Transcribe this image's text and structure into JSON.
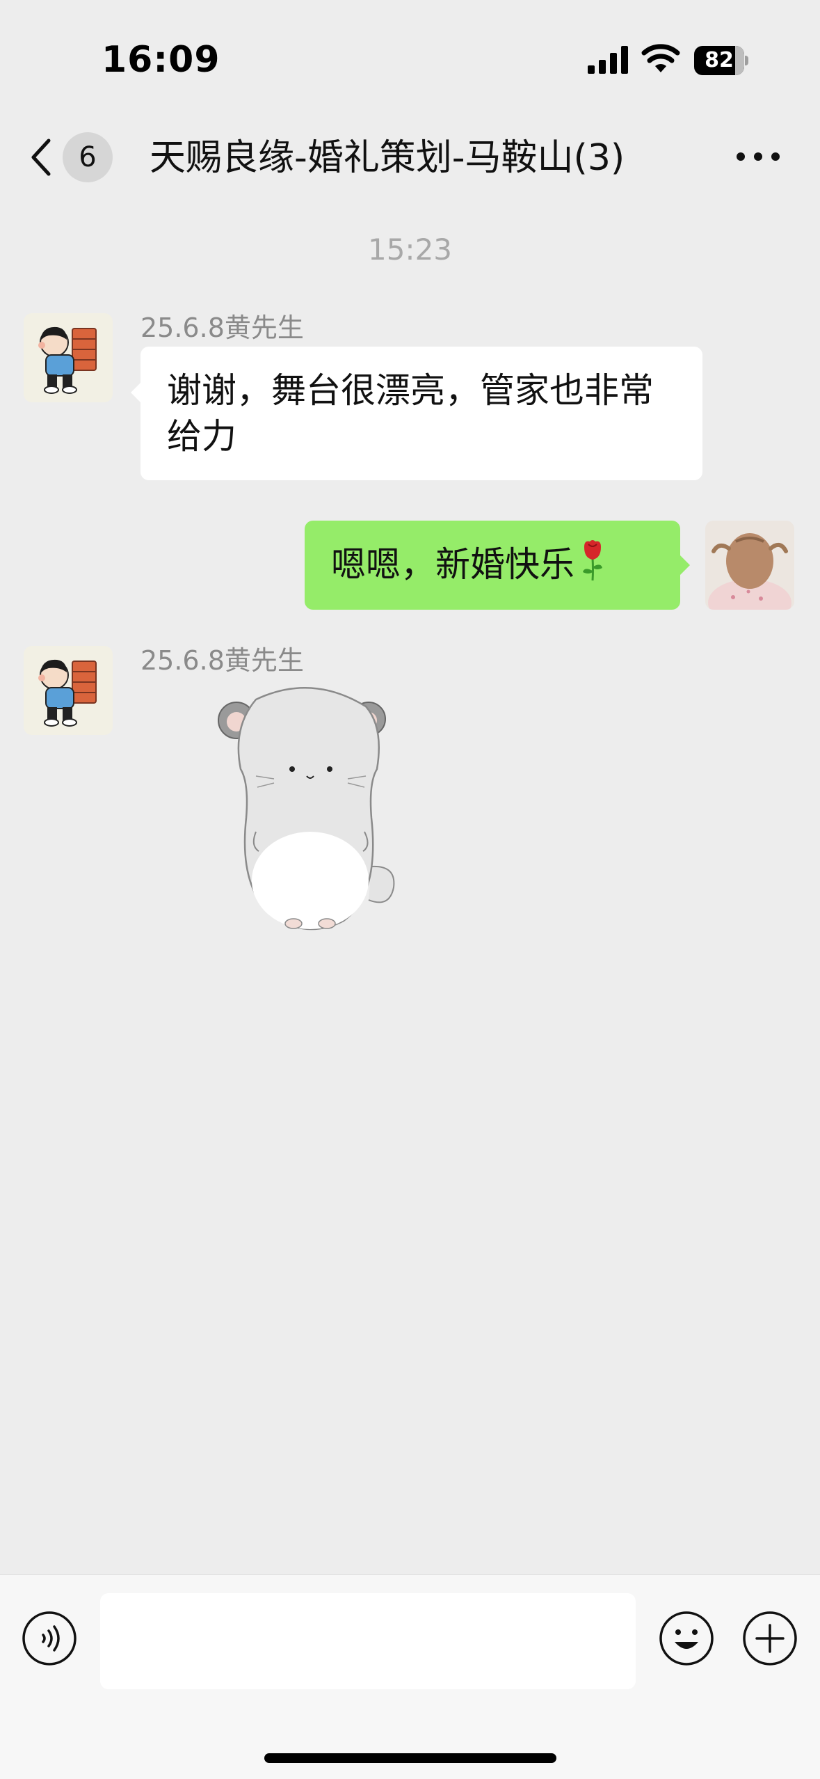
{
  "status_bar": {
    "time": "16:09",
    "battery": "82",
    "battery_level": 0.82
  },
  "nav": {
    "unread_count": "6",
    "title": "天赐良缘-婚礼策划-马鞍山(3)"
  },
  "chat": {
    "timestamp": "15:23",
    "messages": [
      {
        "sender": "25.6.8黄先生",
        "text": "谢谢，舞台很漂亮，管家也非常给力"
      },
      {
        "text": "嗯嗯，新婚快乐",
        "emoji": "rose-icon"
      },
      {
        "sender": "25.6.8黄先生",
        "sticker": "chinchilla-sticker"
      }
    ]
  },
  "colors": {
    "background": "#ededed",
    "outgoing_bubble": "#95ec69",
    "incoming_bubble": "#ffffff"
  },
  "input": {
    "value": ""
  }
}
